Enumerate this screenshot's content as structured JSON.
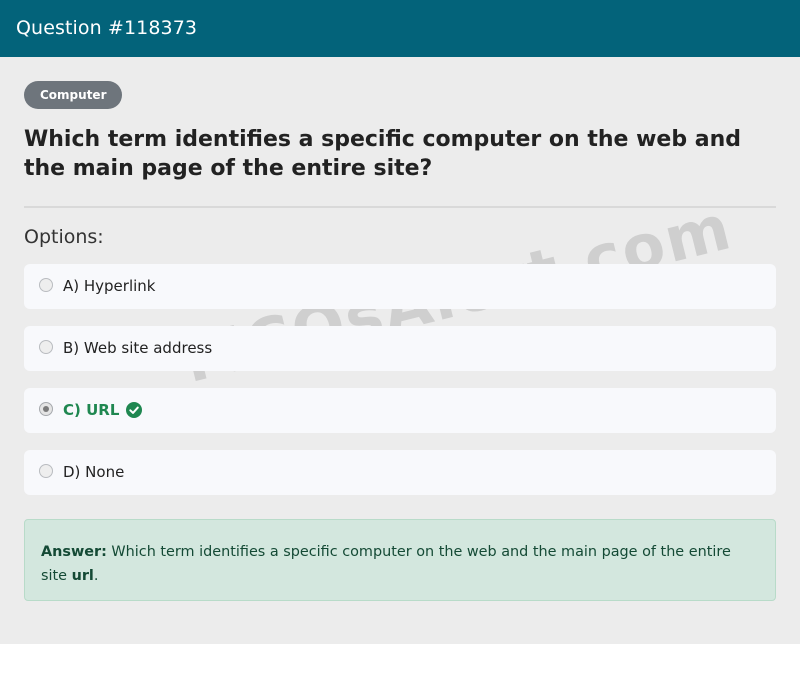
{
  "header": {
    "title": "Question #118373"
  },
  "category": {
    "label": "Computer"
  },
  "question": {
    "text": "Which term identifies a specific computer on the web and the main page of the entire site?"
  },
  "options_label": "Options:",
  "options": [
    {
      "label": "A) Hyperlink",
      "selected": false,
      "correct": false
    },
    {
      "label": "B) Web site address",
      "selected": false,
      "correct": false
    },
    {
      "label": "C) URL",
      "selected": true,
      "correct": true
    },
    {
      "label": "D) None",
      "selected": false,
      "correct": false
    }
  ],
  "watermark": "MCQsAlert.com",
  "answer": {
    "prefix": "Answer:",
    "text": " Which term identifies a specific computer on the web and the main page of the entire site ",
    "value": "url",
    "suffix": "."
  },
  "colors": {
    "header_bg": "#03637a",
    "badge_bg": "#6e757c",
    "correct": "#1f8750",
    "answer_bg": "#d3e7de"
  },
  "icons": {
    "correct": "check-circle-icon"
  }
}
